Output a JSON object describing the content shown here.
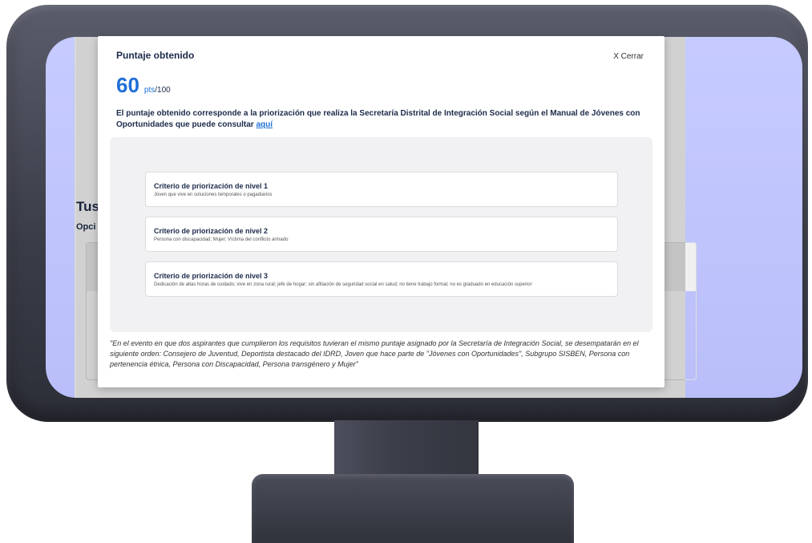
{
  "background": {
    "title": "Tus",
    "subtitle": "Opci"
  },
  "modal": {
    "title": "Puntaje obtenido",
    "close_label": "X Cerrar",
    "score": "60",
    "score_unit": "pts",
    "score_total": "/100",
    "description": "El puntaje obtenido corresponde a la priorización que realiza la Secretaría Distrital de Integración Social según el Manual de Jóvenes con Oportunidades que puede consultar",
    "link_text": "aquí",
    "criteria": [
      {
        "title": "Criterio de priorización de nivel 1",
        "description": "Joven que vive en soluciones temporales o pagadiarios"
      },
      {
        "title": "Criterio de priorización de nivel 2",
        "description": "Persona con discapacidad; Mujer; Víctima del conflicto armado"
      },
      {
        "title": "Criterio de priorización de nivel 3",
        "description": "Dedicación de altas horas de cuidado; vive en zona rural; jefe de hogar; sin afiliación de seguridad social en salud; no tiene trabajo formal; no es graduado en educación superior"
      }
    ],
    "footnote": "\"En el evento en que dos aspirantes que cumplieron los requisitos tuvieran el mismo puntaje asignado por la Secretaría de Integración Social, se desempatarán en el siguiente orden: Consejero de Juventud, Deportista destacado del IDRD, Joven que hace parte de \"Jóvenes con Oportunidades\", Subgrupo SISBEN, Persona con pertenencia étnica, Persona con Discapacidad, Persona transgénero y Mujer\""
  }
}
